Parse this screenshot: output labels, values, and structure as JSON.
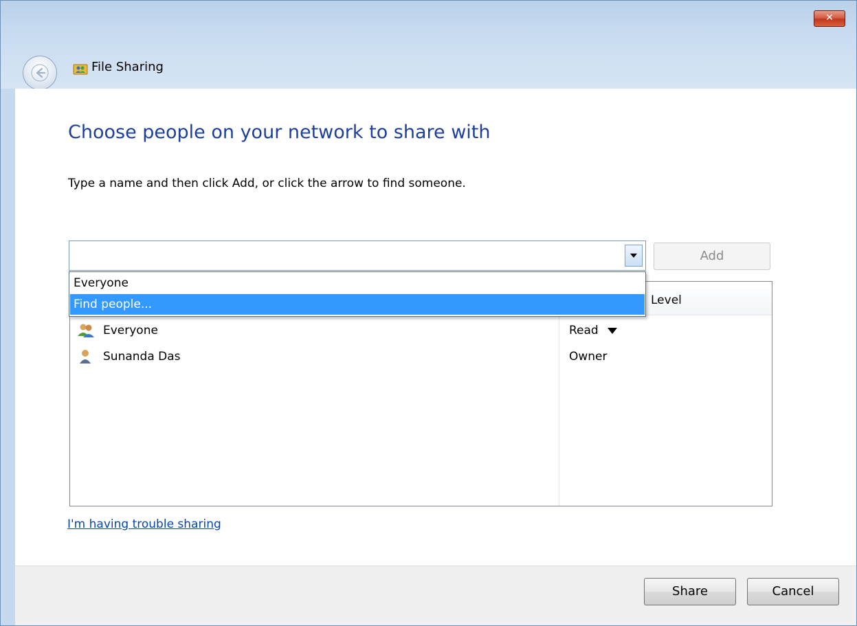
{
  "window": {
    "title": "File Sharing",
    "close_glyph": "✕"
  },
  "main": {
    "heading": "Choose people on your network to share with",
    "instructions": "Type a name and then click Add, or click the arrow to find someone.",
    "name_input": {
      "value": "",
      "placeholder": ""
    },
    "add_label": "Add"
  },
  "dropdown": {
    "items": [
      {
        "label": "Everyone"
      },
      {
        "label": "Find people..."
      }
    ],
    "selected_index": 1
  },
  "list": {
    "header_level": "Level",
    "rows": [
      {
        "name": "Everyone",
        "level": "Read",
        "icon": "group-icon"
      },
      {
        "name": "Sunanda Das",
        "level": "Owner",
        "icon": "user-icon"
      }
    ]
  },
  "help_link": "I'm having trouble sharing",
  "footer": {
    "share_label": "Share",
    "cancel_label": "Cancel"
  },
  "colors": {
    "heading": "#1e3f9a",
    "link": "#0645ad",
    "selection": "#3399ff",
    "title_bar": "#c6d9ef"
  }
}
